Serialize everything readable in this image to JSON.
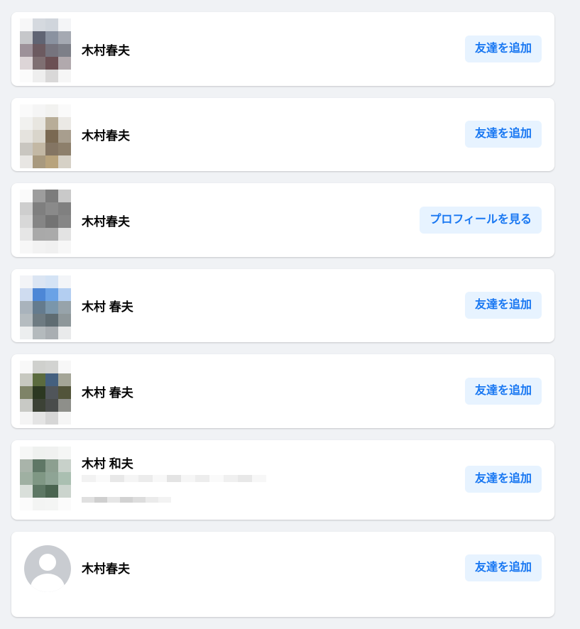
{
  "results": [
    {
      "name": "木村春夫",
      "action_label": "友達を追加",
      "avatar_type": "pixelated",
      "avatar_colors": [
        "#f7f7f8",
        "#d5d9df",
        "#d0d5dc",
        "#f4f5f7",
        "#c6c7ca",
        "#606473",
        "#8a92a0",
        "#a5a9b2",
        "#9d9199",
        "#6c5a60",
        "#76747e",
        "#7d7f88",
        "#ddd5d7",
        "#7f6f72",
        "#6b5054",
        "#b1a9ad",
        "#fbfbfb",
        "#eeeeee",
        "#d9d8d8",
        "#f6f6f6"
      ]
    },
    {
      "name": "木村春夫",
      "action_label": "友達を追加",
      "avatar_type": "pixelated",
      "avatar_colors": [
        "#fafafa",
        "#f5f5f5",
        "#f2f2f0",
        "#fafafa",
        "#f1f1ef",
        "#e8e6e0",
        "#b8ad98",
        "#ebe9e5",
        "#e5e3de",
        "#d9d5cb",
        "#7a6952",
        "#a89e8e",
        "#c9c6c0",
        "#c3b8a4",
        "#847563",
        "#8d7f6b",
        "#e8e6e3",
        "#a8997e",
        "#b8a37c",
        "#d6d1c6"
      ]
    },
    {
      "name": "木村春夫",
      "action_label": "プロフィールを見る",
      "avatar_type": "pixelated",
      "avatar_colors": [
        "#fafafa",
        "#9d9d9d",
        "#7c7c7c",
        "#c9c9c9",
        "#cecece",
        "#7f7f7f",
        "#8a8a8a",
        "#808080",
        "#d8d8d8",
        "#858585",
        "#737373",
        "#868686",
        "#e6e6e6",
        "#a9a9a9",
        "#aaaaaa",
        "#e3e3e3",
        "#f7f7f7",
        "#f2f2f2",
        "#f0f0f0",
        "#f7f7f7"
      ]
    },
    {
      "name": "木村 春夫",
      "action_label": "友達を追加",
      "avatar_type": "pixelated",
      "avatar_colors": [
        "#f3f4f7",
        "#dbe5f3",
        "#d4e3f5",
        "#f3f5f8",
        "#cfdcf0",
        "#4d87d6",
        "#6aa2e6",
        "#b3cef1",
        "#a9b3bc",
        "#647b8e",
        "#7a96ab",
        "#97a3aa",
        "#b5bcc0",
        "#6e7b82",
        "#5f6c72",
        "#8e979a",
        "#eceeef",
        "#b4babd",
        "#a9aeb2",
        "#e9eaeb"
      ]
    },
    {
      "name": "木村 春夫",
      "action_label": "友達を追加",
      "avatar_type": "pixelated",
      "avatar_colors": [
        "#f8f8f8",
        "#cfd0cd",
        "#d2d3d1",
        "#f7f7f7",
        "#c7c8c0",
        "#5b6b3e",
        "#44607f",
        "#a4a597",
        "#7e8367",
        "#2c3821",
        "#50555a",
        "#52543a",
        "#c8c9c5",
        "#3c4236",
        "#494c4b",
        "#8e8f8a",
        "#f4f4f4",
        "#e4e4e4",
        "#d6d6d6",
        "#f5f5f5"
      ]
    },
    {
      "name": "木村 和夫",
      "action_label": "友達を追加",
      "avatar_type": "pixelated",
      "avatar_colors": [
        "#f6f7f6",
        "#eff1ef",
        "#f0f1f0",
        "#f5f6f5",
        "#a9b4aa",
        "#5f7766",
        "#8c9f90",
        "#c8d1ca",
        "#9fb0a2",
        "#7f9784",
        "#8ea495",
        "#aabfb1",
        "#d9dfda",
        "#5d7764",
        "#4a6450",
        "#cbd4cd",
        "#fbfbfb",
        "#f3f4f3",
        "#f4f5f4",
        "#fbfbfb"
      ],
      "has_subline": true,
      "subline_colors_1": [
        "#f2f2f2",
        "#fafafa",
        "#e8e8e8",
        "#f5f5f5",
        "#ececec",
        "#f8f8f8",
        "#e4e4e4",
        "#f6f6f6",
        "#ededed",
        "#fafafa",
        "#f0f0f0",
        "#e8e8e8",
        "#f7f7f7"
      ],
      "subline_colors_2": [
        "#e0e0e0",
        "#cfcfcf",
        "#e6e6e6",
        "#d2d2d2",
        "#dddddd",
        "#ebebeb",
        "#f3f3f3"
      ]
    },
    {
      "name": "木村春夫",
      "action_label": "友達を追加",
      "avatar_type": "default"
    }
  ],
  "colors": {
    "page_bg": "#f0f2f5",
    "card_bg": "#ffffff",
    "button_bg": "#e7f3ff",
    "button_text": "#1877f2",
    "name_text": "#050505"
  }
}
